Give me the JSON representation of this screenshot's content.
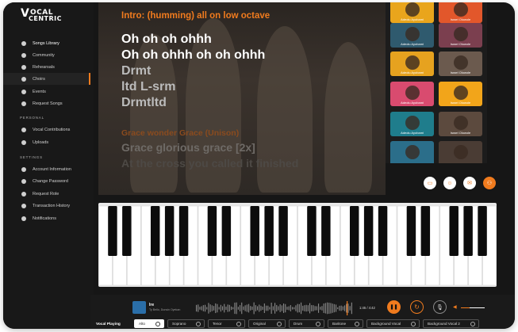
{
  "app": {
    "logo_line1": "OCAL",
    "logo_line2": "CENTRIC",
    "logo_letter": "V"
  },
  "sidebar": {
    "items": [
      {
        "label": "Songs Library",
        "icon": "music-note-icon"
      },
      {
        "label": "Community",
        "icon": "community-icon"
      },
      {
        "label": "Rehearsals",
        "icon": "rehearsal-icon"
      },
      {
        "label": "Choirs",
        "icon": "choir-icon"
      },
      {
        "label": "Events",
        "icon": "calendar-icon"
      },
      {
        "label": "Request Songs",
        "icon": "request-icon"
      }
    ],
    "personal_label": "PERSONAL",
    "personal_items": [
      {
        "label": "Vocal Contributions",
        "icon": "mic-icon"
      },
      {
        "label": "Uploads",
        "icon": "upload-icon"
      }
    ],
    "settings_label": "SETTINGS",
    "settings_items": [
      {
        "label": "Account Information",
        "icon": "user-icon"
      },
      {
        "label": "Change Password",
        "icon": "lock-icon"
      },
      {
        "label": "Request Role",
        "icon": "role-icon"
      },
      {
        "label": "Transaction History",
        "icon": "history-icon"
      },
      {
        "label": "Notifications",
        "icon": "bell-icon"
      }
    ]
  },
  "lyrics": {
    "intro": "Intro: (humming) all on low octave",
    "lines": [
      "Oh oh oh ohhh",
      "Oh oh ohhh oh oh ohhh",
      "Drmt",
      "ltd L-srm",
      "Drmtltd"
    ],
    "section2": "Grace wonder Grace (Unison)",
    "section2_lines": [
      "Grace glorious grace [2x]",
      "At the cross you called it finished"
    ]
  },
  "gallery": {
    "names": [
      "Adeolu Ayobami",
      "Israel Olowole",
      "Adeolu Ayobami",
      "Israel Olowole",
      "Adeolu Ayobami",
      "Israel Olowole",
      "Adeolu Ayobami",
      "Israel Olowole",
      "Adeolu Ayobami",
      "Israel Olowole",
      "",
      ""
    ]
  },
  "player": {
    "title": "Ire",
    "artist": "Ty Bello, Dunsin Oyekan",
    "time": "1:45 / 4:42",
    "volume": 0.35
  },
  "vocal": {
    "label": "Vocal Playing",
    "chips": [
      "Alto",
      "Soprano",
      "Tenor",
      "Original",
      "Drum",
      "Baritone",
      "Background Vocal",
      "Background Vocal 2"
    ]
  },
  "colors": {
    "accent": "#f07b1e",
    "background": "#161616"
  }
}
